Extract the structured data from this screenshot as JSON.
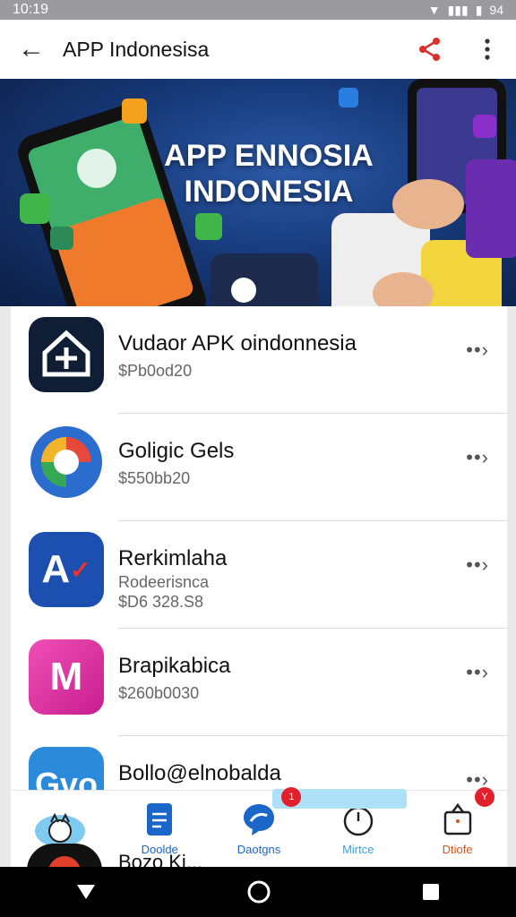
{
  "status_bar": {
    "time": "10:19",
    "battery": "94"
  },
  "app_bar": {
    "title": "APP Indonesisa"
  },
  "banner": {
    "line1": "APP ENNOSIA",
    "line2": "INDONESIA"
  },
  "apps": [
    {
      "name": "Vudaor APK oindonnesia",
      "sub1": "$Pb0od20",
      "sub2": "",
      "icon_color": "#0f1e35"
    },
    {
      "name": "Goligic Gels",
      "sub1": "$550bb20",
      "sub2": "",
      "icon_color": "#2b6ccf"
    },
    {
      "name": "Rerkimlaha",
      "sub1": "Rodeerisnca",
      "sub2": "$D6 328.S8",
      "icon_color": "#1c4fb0"
    },
    {
      "name": "Brapikabica",
      "sub1": "$260b0030",
      "sub2": "",
      "icon_color": "#e03aa7"
    },
    {
      "name": "Bollo@elnobalda",
      "sub1": "",
      "sub2": "",
      "icon_color": "#2b8ad9"
    }
  ],
  "peek_item": {
    "name": "Bozo Ki..."
  },
  "bottom_nav": [
    {
      "label": "",
      "color": "#2aa6e8"
    },
    {
      "label": "Doolde",
      "color": "#1a66c9"
    },
    {
      "label": "Daotgns",
      "color": "#1a66c9"
    },
    {
      "label": "Mirtce",
      "color": "#2aa6e8"
    },
    {
      "label": "Dtiofe",
      "color": "#d4541a"
    }
  ],
  "badges": {
    "mirtce": "1",
    "dtiofe": "Y"
  }
}
